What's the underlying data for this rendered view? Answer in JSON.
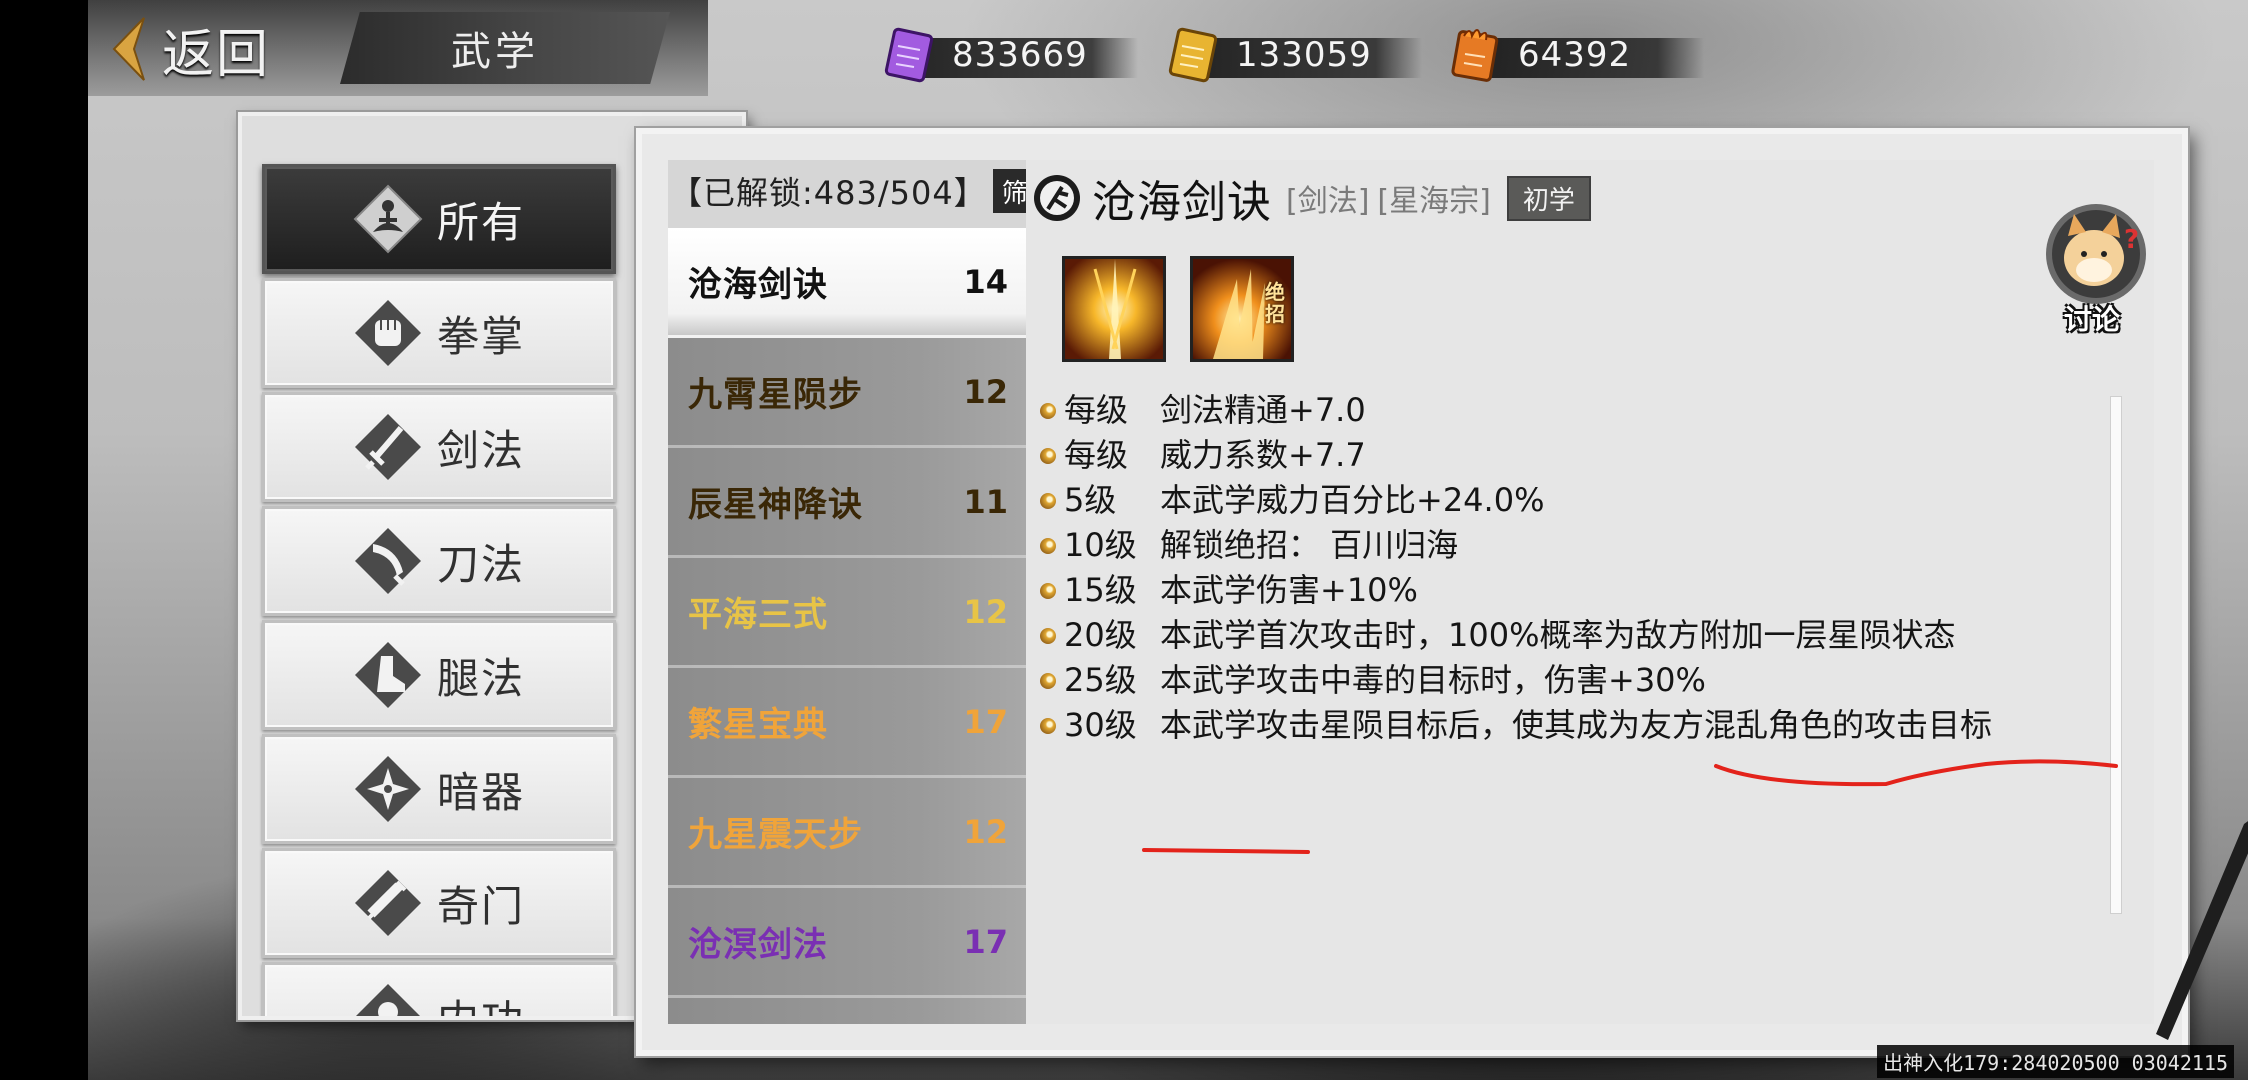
{
  "header": {
    "back_label": "返回",
    "title": "武学"
  },
  "currencies": [
    {
      "icon": "purple-scroll-icon",
      "color": "#9b4fd6",
      "value": "833669"
    },
    {
      "icon": "gold-scroll-icon",
      "color": "#e1a823",
      "value": "133059"
    },
    {
      "icon": "flame-scroll-icon",
      "color": "#e0731f",
      "value": "64392"
    }
  ],
  "categories": [
    {
      "icon": "meditation-icon",
      "label": "所有",
      "active": true
    },
    {
      "icon": "fist-icon",
      "label": "拳掌"
    },
    {
      "icon": "sword-icon",
      "label": "剑法"
    },
    {
      "icon": "saber-icon",
      "label": "刀法"
    },
    {
      "icon": "boot-icon",
      "label": "腿法"
    },
    {
      "icon": "shuriken-icon",
      "label": "暗器"
    },
    {
      "icon": "scroll-weapon-icon",
      "label": "奇门"
    },
    {
      "icon": "inner-power-icon",
      "label": "内功"
    }
  ],
  "list": {
    "unlock_text": "【已解锁:483/504】",
    "filter_label": "筛",
    "skills": [
      {
        "name": "沧海剑诀",
        "level": "14",
        "color": "#111111",
        "active": true
      },
      {
        "name": "九霄星陨步",
        "level": "12",
        "color": "#3a2706"
      },
      {
        "name": "辰星神降诀",
        "level": "11",
        "color": "#3a2706"
      },
      {
        "name": "平海三式",
        "level": "12",
        "color": "#e8c446"
      },
      {
        "name": "繁星宝典",
        "level": "17",
        "color": "#f0a43a"
      },
      {
        "name": "九星震天步",
        "level": "12",
        "color": "#f0a43a"
      },
      {
        "name": "沧溟剑法",
        "level": "17",
        "color": "#7a2fb3"
      }
    ]
  },
  "detail": {
    "title": "沧海剑诀",
    "tags": [
      "[剑法]",
      "[星海宗]"
    ],
    "badge": "初学",
    "discuss_label": "讨论",
    "ultimate_tag": "绝招",
    "bonuses": [
      {
        "level": "每级",
        "text": "剑法精通+7.0"
      },
      {
        "level": "每级",
        "text": "威力系数+7.7"
      },
      {
        "level": "5级",
        "text": "本武学威力百分比+24.0%"
      },
      {
        "level": "10级",
        "text": "解锁绝招：  百川归海"
      },
      {
        "level": "15级",
        "text": "本武学伤害+10%"
      },
      {
        "level": "20级",
        "text": "本武学首次攻击时，100%概率为敌方附加一层星陨状态"
      },
      {
        "level": "25级",
        "text": "本武学攻击中毒的目标时，伤害+30%"
      },
      {
        "level": "30级",
        "text": "本武学攻击星陨目标后，使其成为友方混乱角色的攻击目标"
      }
    ]
  },
  "footer": {
    "stamp": "出神入化179:284020500 03042115"
  }
}
